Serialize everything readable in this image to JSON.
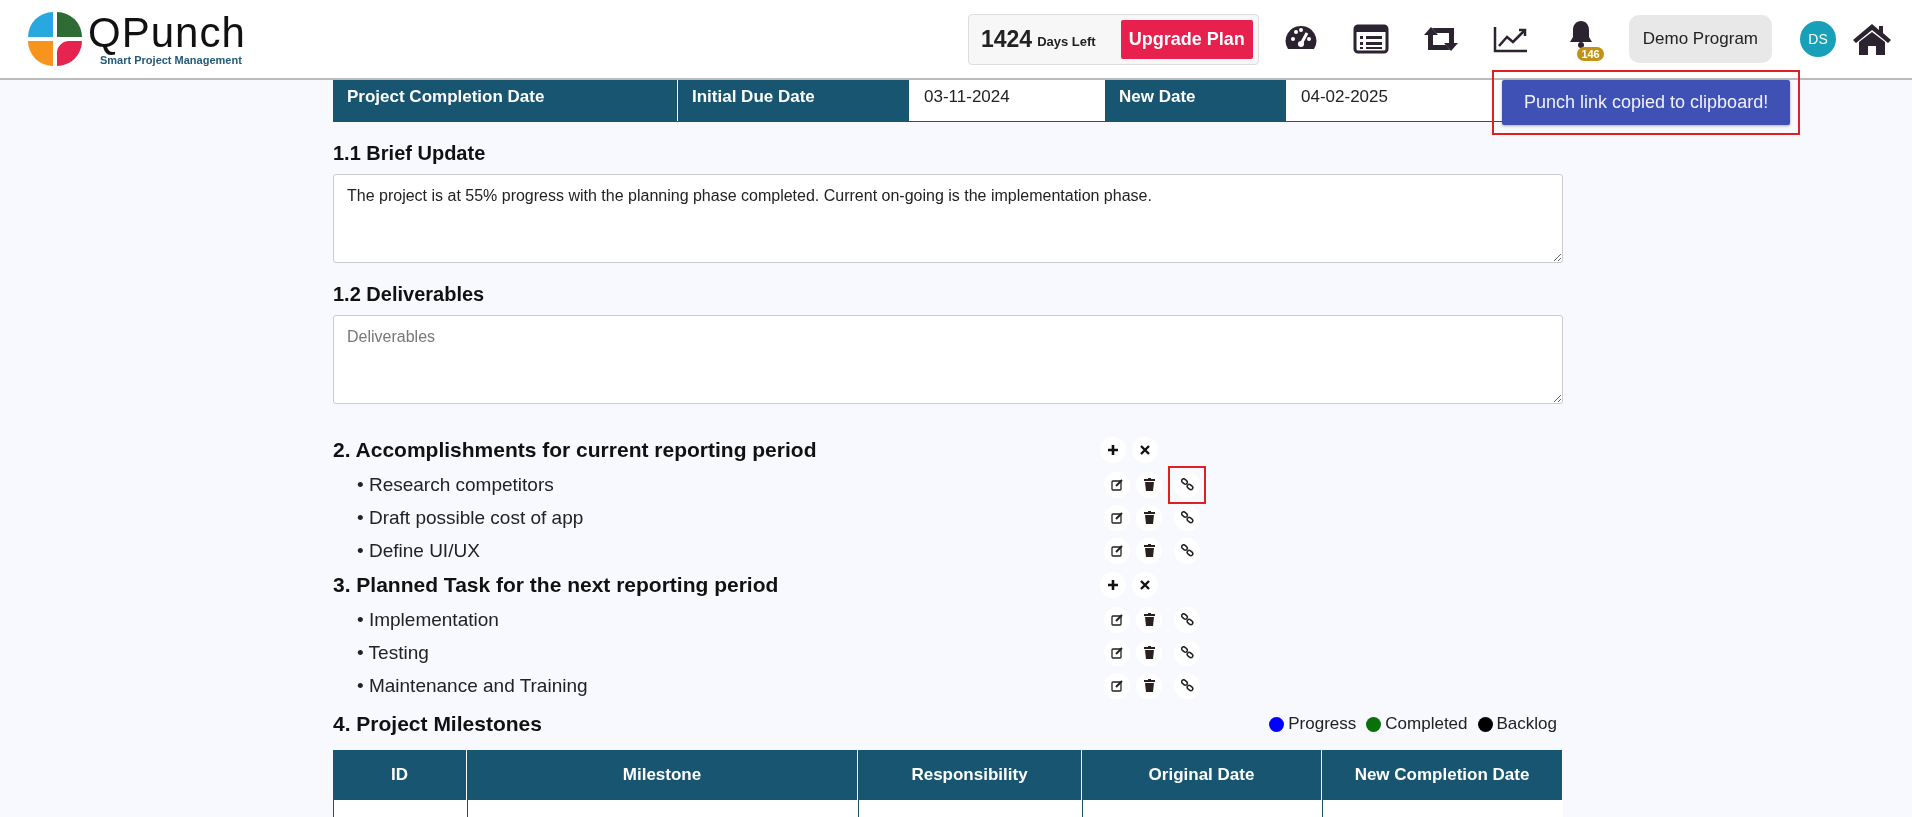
{
  "header": {
    "logo": {
      "name": "QPunch",
      "tagline": "Smart Project Management"
    },
    "plan": {
      "days": "1424",
      "days_label": "Days Left",
      "upgrade": "Upgrade Plan"
    },
    "icons": [
      {
        "kind": "gauge"
      },
      {
        "kind": "list"
      },
      {
        "kind": "retweet"
      },
      {
        "kind": "chart"
      },
      {
        "kind": "bell",
        "badge": "146"
      }
    ],
    "program": "Demo Program",
    "avatar": "DS"
  },
  "toast": {
    "text": "Punch link copied to clipboard!",
    "highlighted": true
  },
  "dates": [
    {
      "kind": "label",
      "text": "Project Completion Date"
    },
    {
      "kind": "label",
      "text": "Initial Due Date"
    },
    {
      "kind": "value",
      "text": "03-11-2024"
    },
    {
      "kind": "label",
      "text": "New Date"
    },
    {
      "kind": "value",
      "text": "04-02-2025"
    }
  ],
  "brief": {
    "title": "1.1 Brief Update",
    "value": "The project is at 55% progress with the planning phase completed. Current on-going is the implementation phase."
  },
  "deliverables": {
    "title": "1.2 Deliverables",
    "placeholder": "Deliverables"
  },
  "sections": [
    {
      "title": "2. Accomplishments for current reporting period",
      "items": [
        {
          "text": "• Research competitors",
          "highlighted": true
        },
        {
          "text": "• Draft possible cost of app",
          "highlighted": false
        },
        {
          "text": "• Define UI/UX",
          "highlighted": false
        }
      ]
    },
    {
      "title": "3. Planned Task for the next reporting period",
      "items": [
        {
          "text": "• Implementation",
          "highlighted": false
        },
        {
          "text": "• Testing",
          "highlighted": false
        },
        {
          "text": "• Maintenance and Training",
          "highlighted": false
        }
      ]
    }
  ],
  "milestones": {
    "title": "4. Project Milestones",
    "legend": [
      {
        "label": "Progress",
        "color": "#0000ff"
      },
      {
        "label": "Completed",
        "color": "#0a700a"
      },
      {
        "label": "Backlog",
        "color": "#000000"
      }
    ],
    "columns": [
      "ID",
      "Milestone",
      "Responsibility",
      "Original Date",
      "New Completion Date"
    ]
  }
}
